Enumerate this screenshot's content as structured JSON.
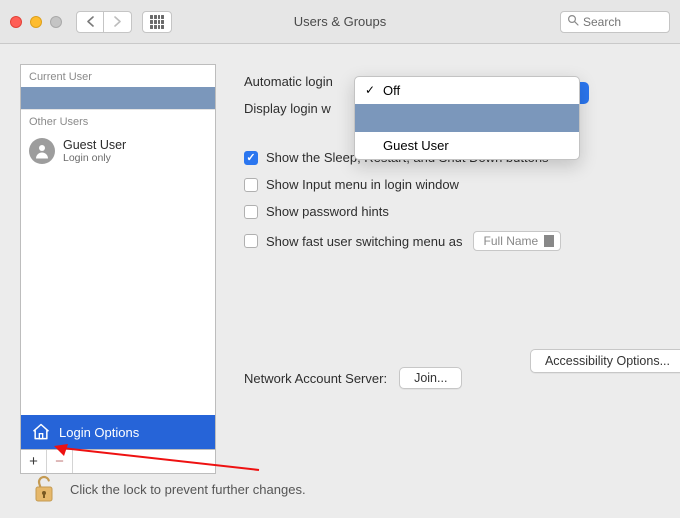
{
  "window": {
    "title": "Users & Groups",
    "search_placeholder": "Search"
  },
  "sidebar": {
    "current_header": "Current User",
    "other_header": "Other Users",
    "guest": {
      "name": "Guest User",
      "sub": "Login only"
    },
    "login_options": "Login Options"
  },
  "pane": {
    "auto_login_label": "Automatic login",
    "display_login_label": "Display login w",
    "cb_sleep": "Show the Sleep, Restart, and Shut Down buttons",
    "cb_input": "Show Input menu in login window",
    "cb_pwd": "Show password hints",
    "cb_fast": "Show fast user switching menu as",
    "fast_value": "Full Name",
    "accessibility": "Accessibility Options...",
    "network_label": "Network Account Server:",
    "join_btn": "Join..."
  },
  "dropdown": {
    "opt_off": "Off",
    "opt_guest": "Guest User"
  },
  "footer": {
    "text": "Click the lock to prevent further changes."
  }
}
